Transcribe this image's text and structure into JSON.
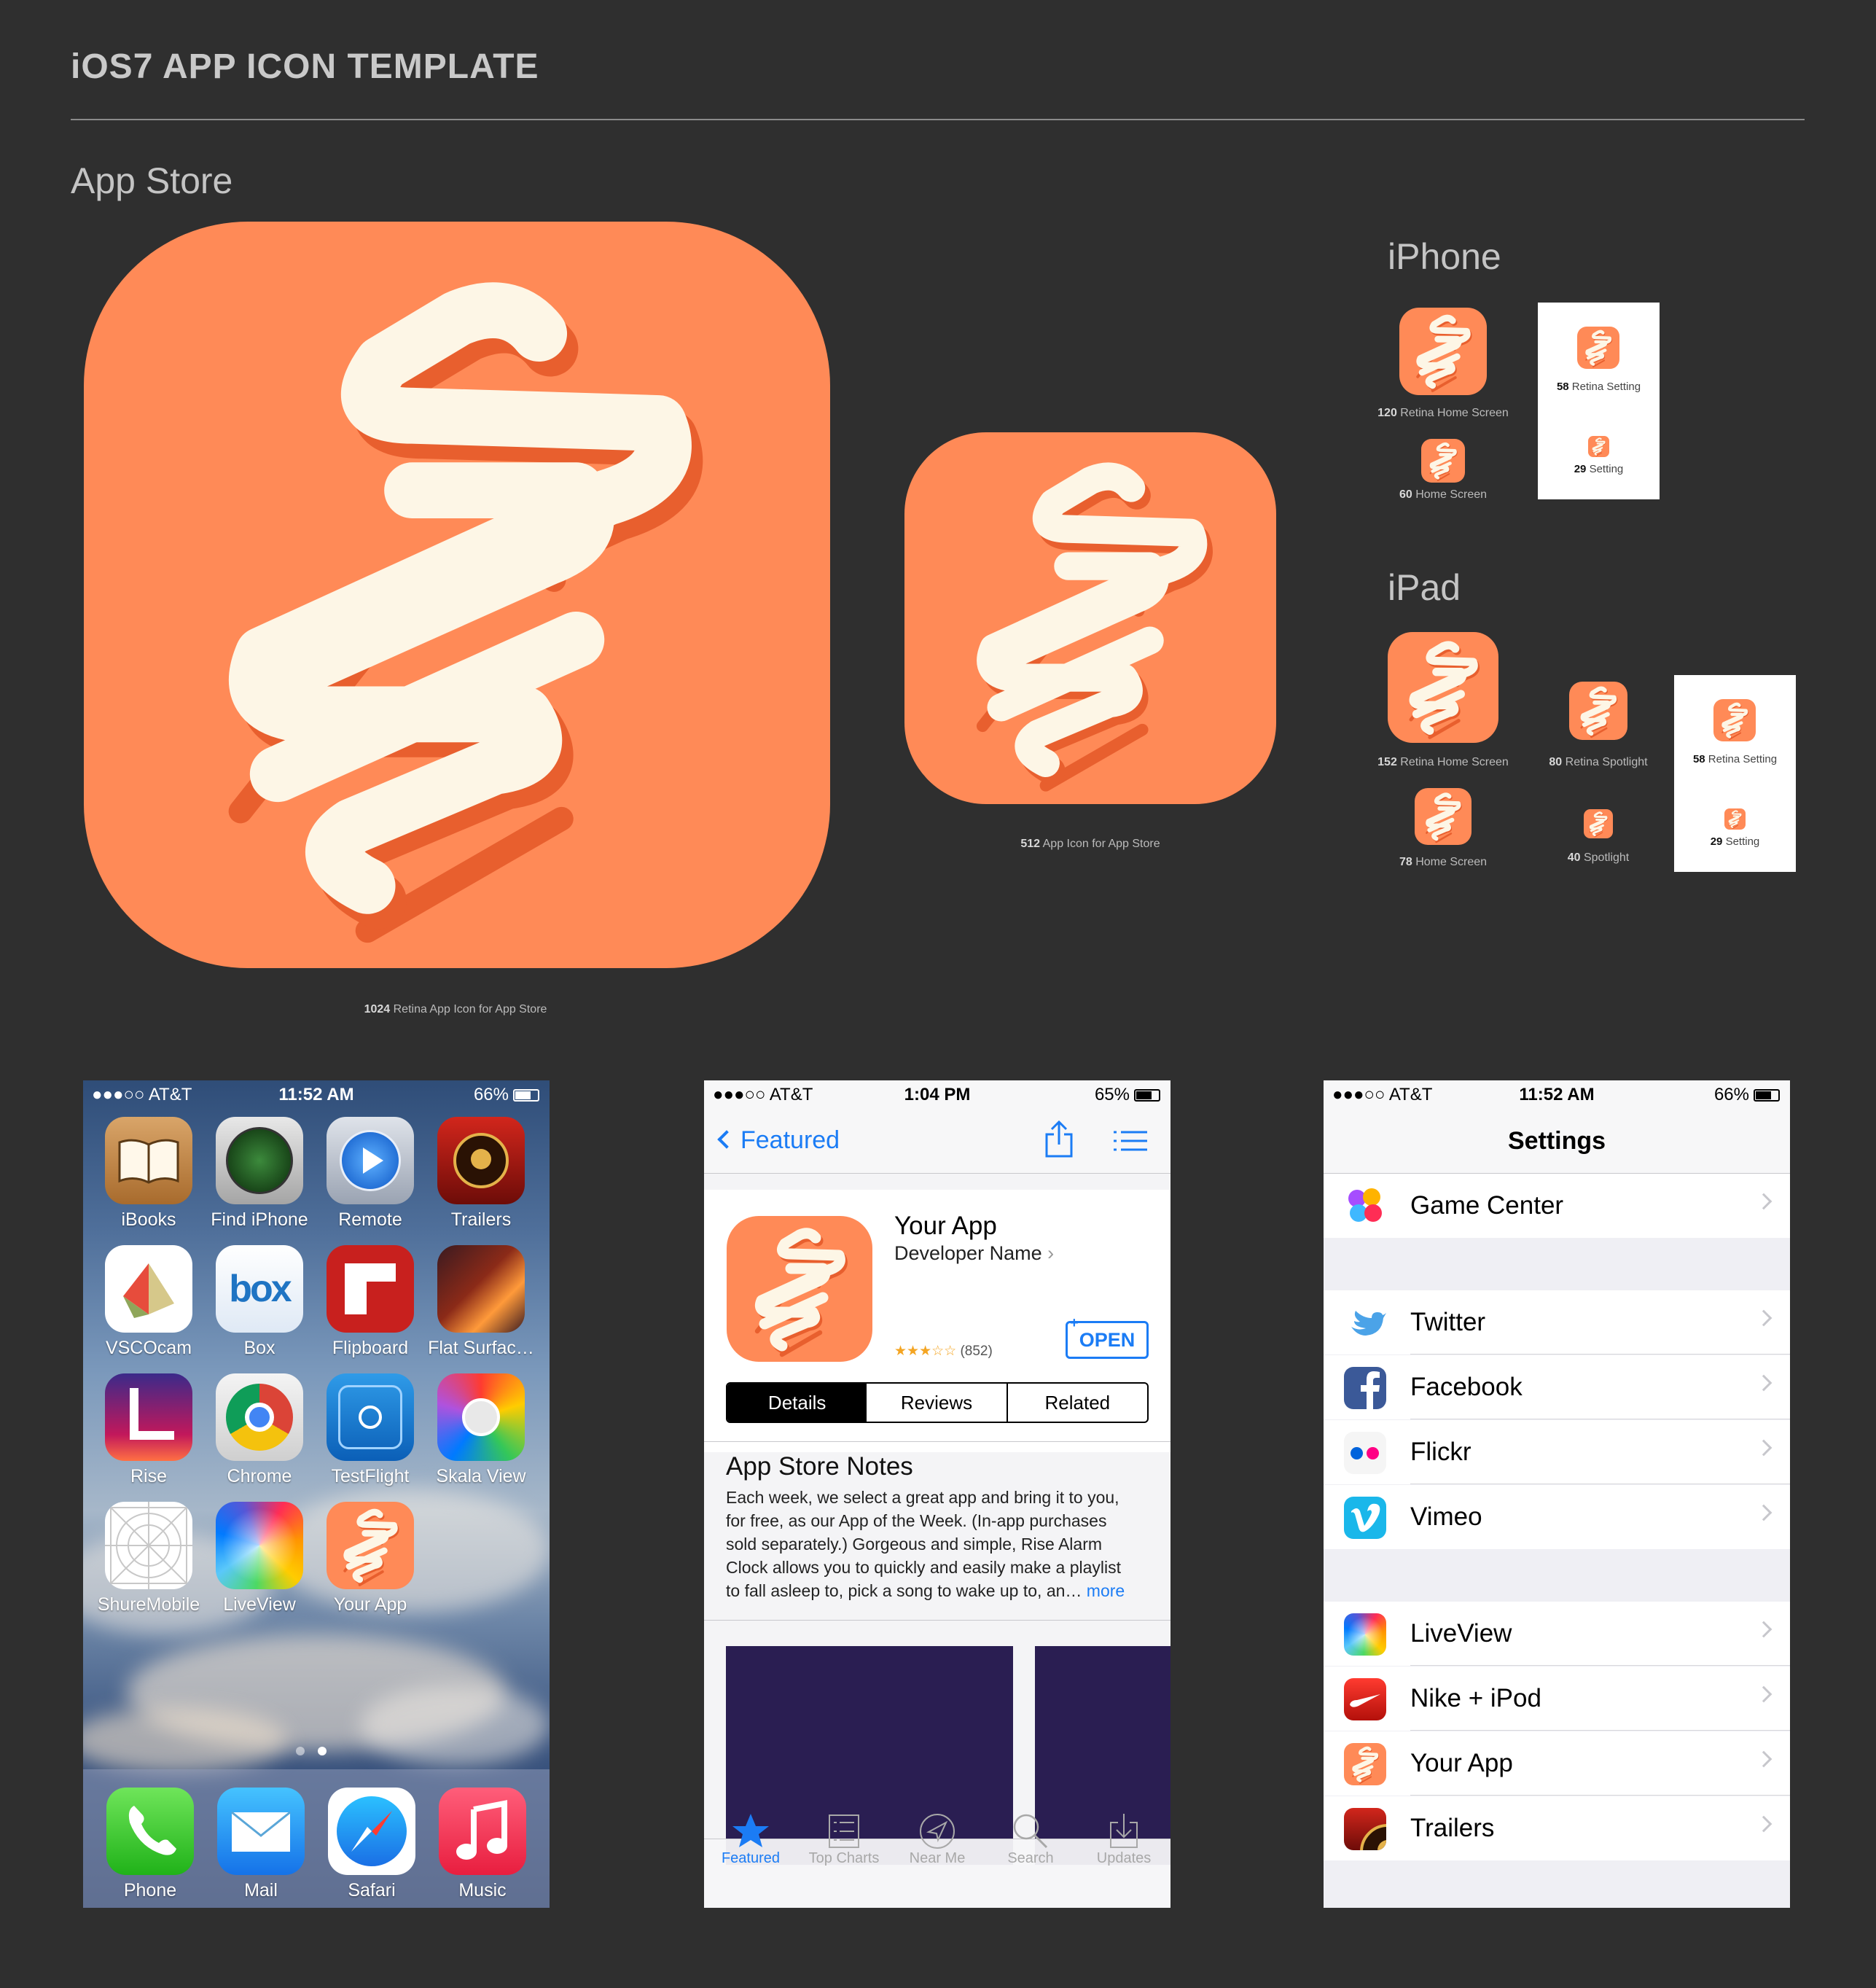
{
  "title": "iOS7 APP ICON TEMPLATE",
  "sections": {
    "app_store": "App Store",
    "iphone": "iPhone",
    "ipad": "iPad"
  },
  "captions": {
    "big": {
      "b": "1024",
      "t": " Retina App Icon for App Store"
    },
    "mid": {
      "b": "512",
      "t": " App Icon for App Store"
    },
    "iphone_120": {
      "b": "120",
      "t": " Retina Home Screen"
    },
    "iphone_60": {
      "b": "60",
      "t": " Home Screen"
    },
    "iphone_58": {
      "b": "58",
      "t": " Retina Setting"
    },
    "iphone_29": {
      "b": "29",
      "t": " Setting"
    },
    "ipad_152": {
      "b": "152",
      "t": " Retina Home Screen"
    },
    "ipad_78": {
      "b": "78",
      "t": " Home Screen"
    },
    "ipad_80": {
      "b": "80",
      "t": " Retina Spotlight"
    },
    "ipad_40": {
      "b": "40",
      "t": " Spotlight"
    },
    "ipad_58": {
      "b": "58",
      "t": " Retina Setting"
    },
    "ipad_29": {
      "b": "29",
      "t": " Setting"
    }
  },
  "colors": {
    "icon_orange": "#ff8a57",
    "glyph_cream": "#fdf6e6",
    "ios_blue": "#1b7cf5",
    "background": "#2f2f2f"
  },
  "home": {
    "carrier": "●●●○○ AT&T",
    "time": "11:52 AM",
    "battery": "66%",
    "battery_fill": 0.66,
    "apps": [
      "iBooks",
      "Find iPhone",
      "Remote",
      "Trailers",
      "VSCOcam",
      "Box",
      "Flipboard",
      "Flat Surfac…",
      "Rise",
      "Chrome",
      "TestFlight",
      "Skala View",
      "ShureMobile",
      "LiveView",
      "Your App"
    ],
    "dock": [
      "Phone",
      "Mail",
      "Safari",
      "Music"
    ],
    "box_text": "box"
  },
  "appstore": {
    "carrier": "●●●○○ AT&T",
    "time": "1:04 PM",
    "battery": "65%",
    "battery_fill": 0.65,
    "back": "Featured",
    "app_name": "Your App",
    "developer": "Developer Name",
    "rating_count": "(852)",
    "rating": 3,
    "stars": "★★★☆☆",
    "open": "OPEN",
    "segments": [
      "Details",
      "Reviews",
      "Related"
    ],
    "notes_title": "App Store Notes",
    "notes_lines": [
      "Each week, we select a great app and bring it to you,",
      "for free, as our App of the Week. (In-app purchases",
      "sold separately.) Gorgeous and simple, Rise Alarm",
      "Clock allows you to quickly and easily make a playlist",
      "to fall asleep to, pick a song to wake up to, an…"
    ],
    "more": "more",
    "tabs": [
      "Featured",
      "Top Charts",
      "Near Me",
      "Search",
      "Updates"
    ]
  },
  "settings": {
    "carrier": "●●●○○ AT&T",
    "time": "11:52 AM",
    "battery": "66%",
    "battery_fill": 0.66,
    "title": "Settings",
    "items": [
      "Game Center",
      "Twitter",
      "Facebook",
      "Flickr",
      "Vimeo",
      "LiveView",
      "Nike + iPod",
      "Your App",
      "Trailers"
    ]
  }
}
